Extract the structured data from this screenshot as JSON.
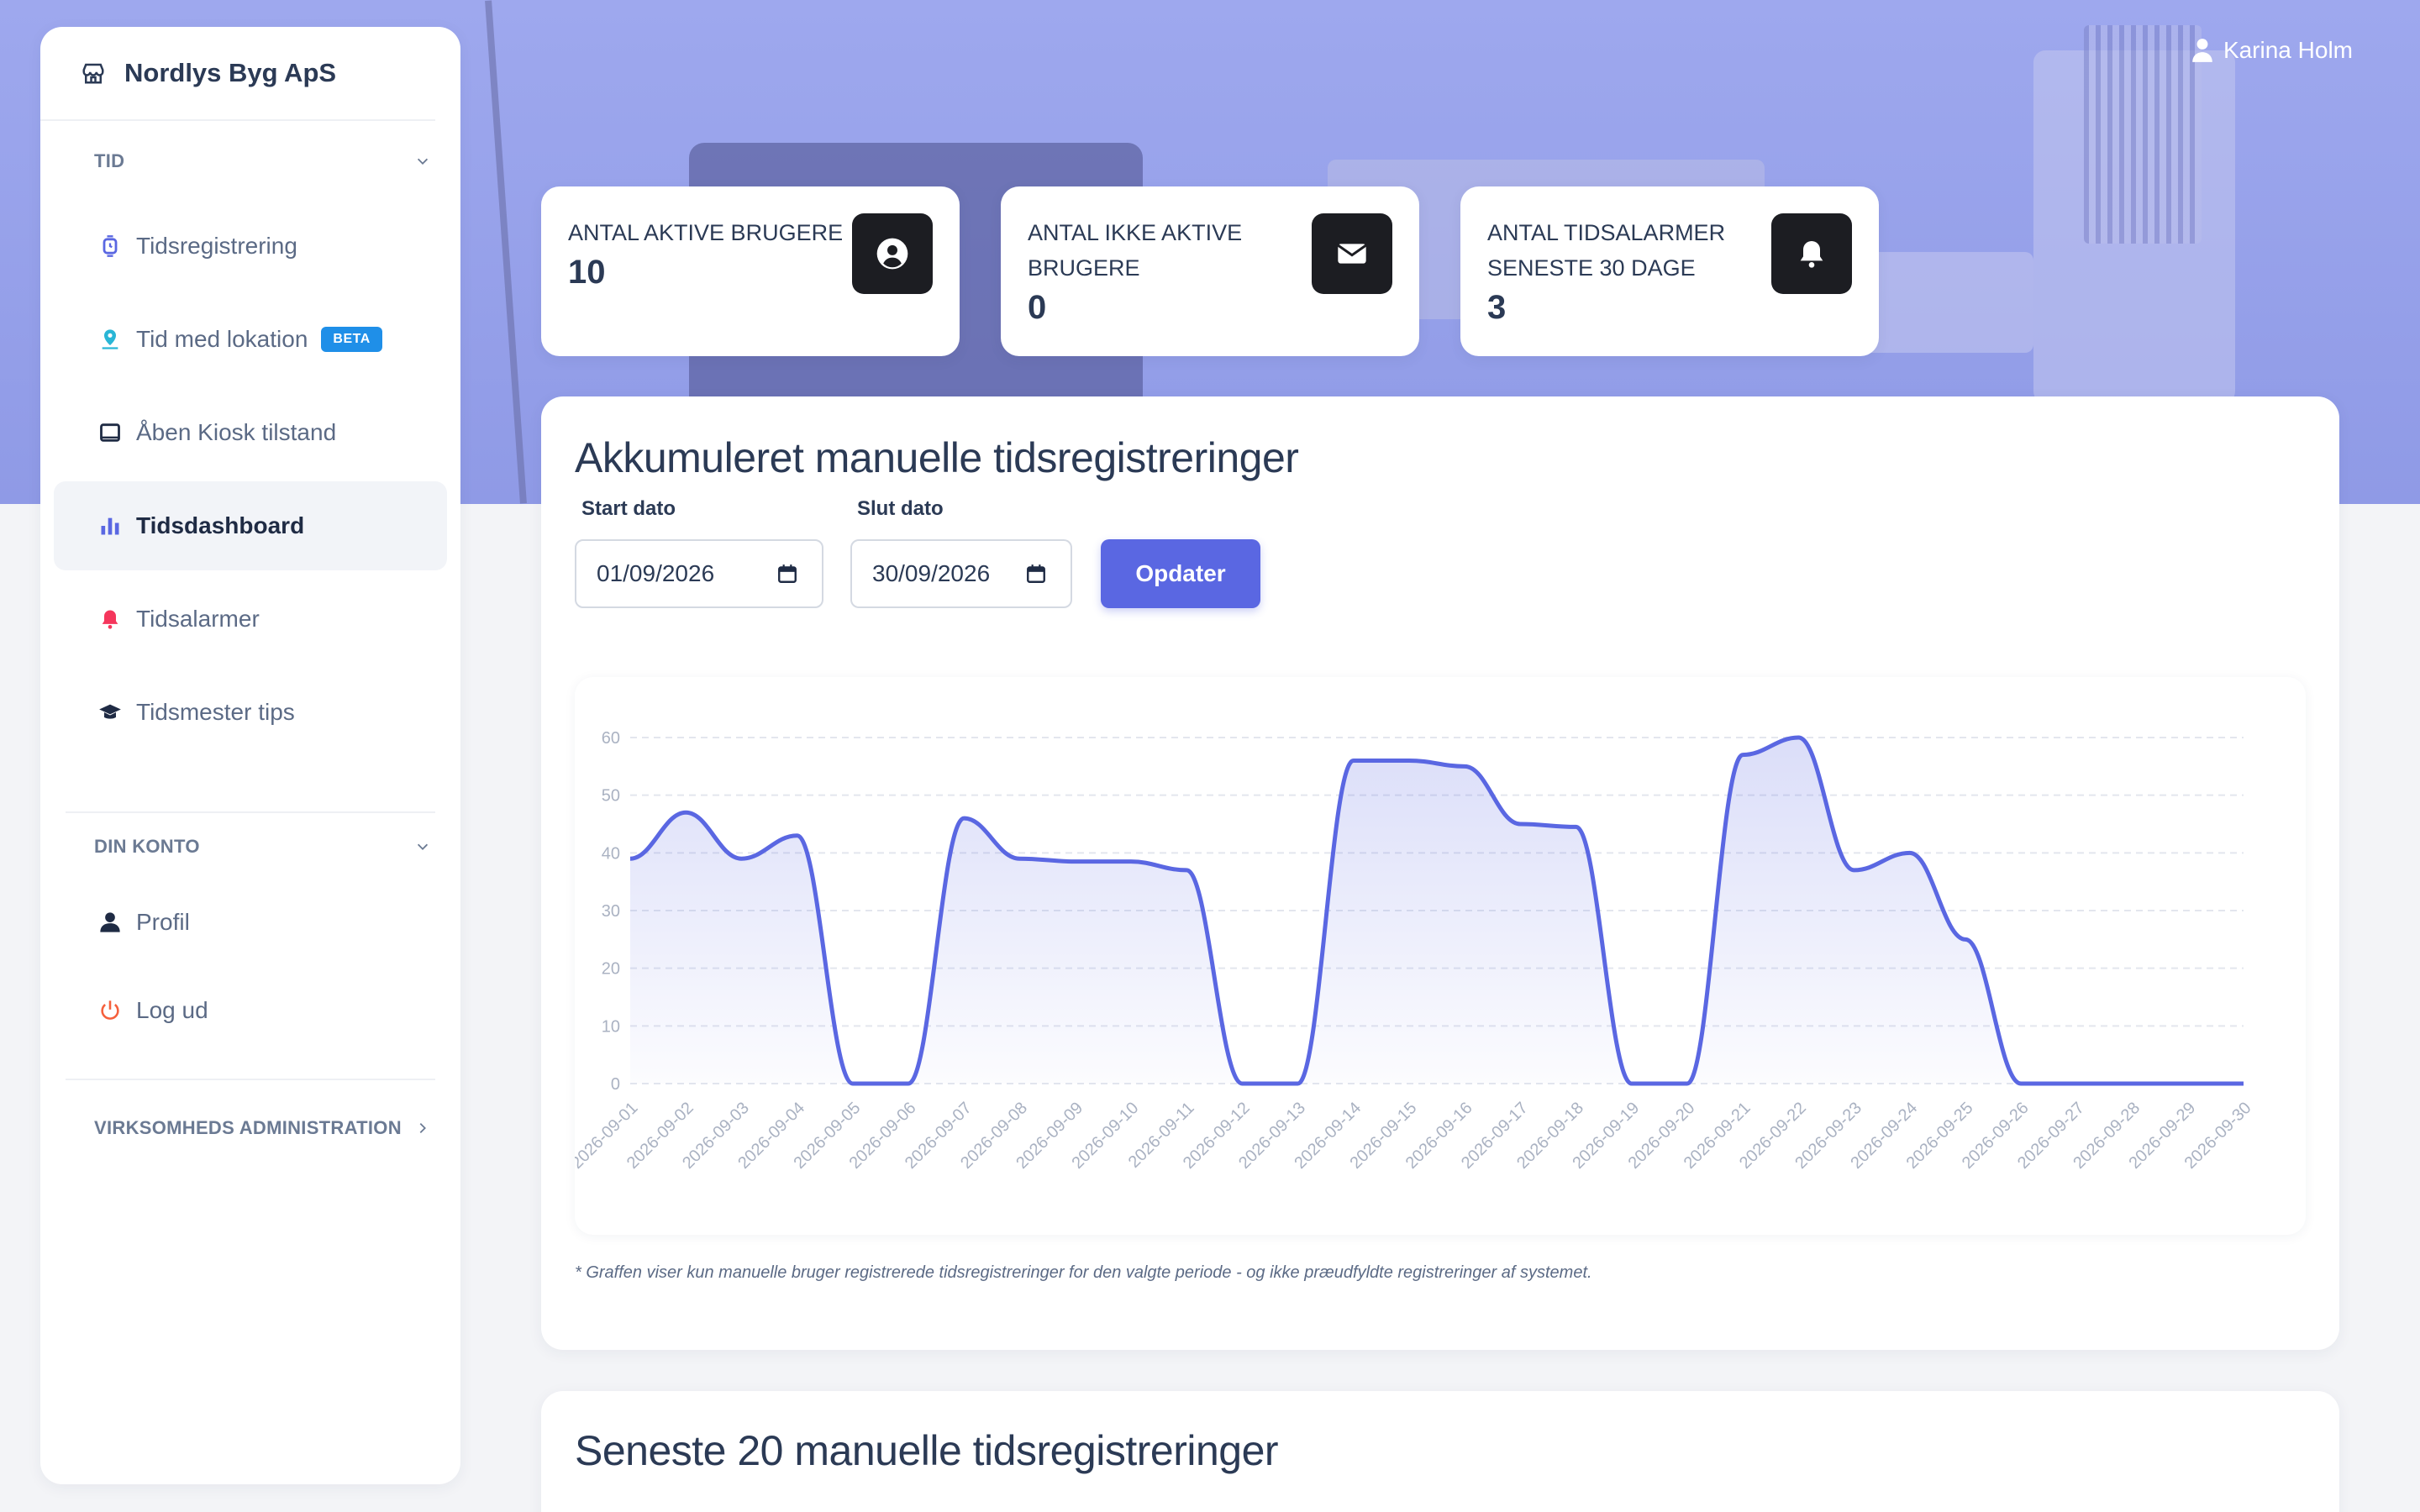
{
  "app": {
    "brand": "Nordlys Byg ApS",
    "user": "Karina Holm"
  },
  "sidebar": {
    "sections": {
      "tid": "TID",
      "konto": "DIN KONTO",
      "admin": "VIRKSOMHEDS ADMINISTRATION"
    },
    "items": [
      {
        "label": "Tidsregistrering",
        "icon": "watch-icon"
      },
      {
        "label": "Tid med lokation",
        "icon": "map-pin-icon",
        "badge": "BETA"
      },
      {
        "label": "Åben Kiosk tilstand",
        "icon": "tablet-icon"
      },
      {
        "label": "Tidsdashboard",
        "icon": "bar-chart-icon"
      },
      {
        "label": "Tidsalarmer",
        "icon": "bell-icon"
      },
      {
        "label": "Tidsmester tips",
        "icon": "graduation-cap-icon"
      }
    ],
    "account_items": [
      {
        "label": "Profil",
        "icon": "user-icon"
      },
      {
        "label": "Log ud",
        "icon": "power-icon"
      }
    ]
  },
  "stats": [
    {
      "label": "ANTAL AKTIVE BRUGERE",
      "value": "10",
      "icon": "user-circle-icon"
    },
    {
      "label": "ANTAL IKKE AKTIVE BRUGERE",
      "value": "0",
      "icon": "envelope-icon"
    },
    {
      "label": "ANTAL TIDSALARMER SENESTE 30 DAGE",
      "value": "3",
      "icon": "bell-icon"
    }
  ],
  "dashboard": {
    "title": "Akkumuleret manuelle tidsregistreringer",
    "start_label": "Start dato",
    "start_value": "01/09/2026",
    "end_label": "Slut dato",
    "end_value": "30/09/2026",
    "update_button": "Opdater",
    "footnote": "* Graffen viser kun manuelle bruger registrerede tidsregistreringer for den valgte periode - og ikke præudfyldte registreringer af systemet."
  },
  "recent": {
    "title": "Seneste 20 manuelle tidsregistreringer"
  },
  "chart_data": {
    "type": "area",
    "x": [
      "2026-09-01",
      "2026-09-02",
      "2026-09-03",
      "2026-09-04",
      "2026-09-05",
      "2026-09-06",
      "2026-09-07",
      "2026-09-08",
      "2026-09-09",
      "2026-09-10",
      "2026-09-11",
      "2026-09-12",
      "2026-09-13",
      "2026-09-14",
      "2026-09-15",
      "2026-09-16",
      "2026-09-17",
      "2026-09-18",
      "2026-09-19",
      "2026-09-20",
      "2026-09-21",
      "2026-09-22",
      "2026-09-23",
      "2026-09-24",
      "2026-09-25",
      "2026-09-26",
      "2026-09-27",
      "2026-09-28",
      "2026-09-29",
      "2026-09-30"
    ],
    "series": [
      {
        "values": [
          39,
          47,
          39,
          43,
          0,
          0,
          46,
          39,
          38.5,
          38.5,
          37,
          0,
          0,
          56,
          56,
          55,
          45,
          44.5,
          0,
          0,
          57,
          60,
          37,
          40,
          25,
          0,
          0,
          0,
          0,
          0
        ]
      }
    ],
    "yticks": [
      0,
      10,
      20,
      30,
      40,
      50,
      60
    ],
    "ylim": [
      0,
      60
    ],
    "color": "#5a67e2",
    "grid": true
  }
}
